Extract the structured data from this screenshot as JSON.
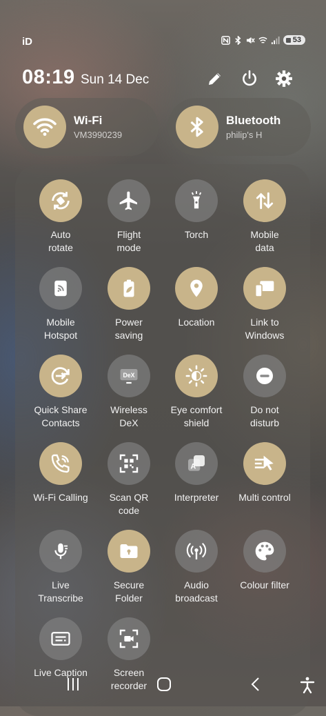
{
  "status_bar": {
    "left": "iD",
    "battery": "53"
  },
  "header": {
    "time": "08:19",
    "date": "Sun 14 Dec"
  },
  "pills": [
    {
      "title": "Wi-Fi",
      "subtitle": "VM3990239"
    },
    {
      "title": "Bluetooth",
      "subtitle": "philip's H"
    }
  ],
  "tiles": [
    {
      "label": "Auto\nrotate",
      "on": true,
      "icon": "auto-rotate-icon"
    },
    {
      "label": "Flight\nmode",
      "on": false,
      "icon": "airplane-icon"
    },
    {
      "label": "Torch",
      "on": false,
      "icon": "torch-icon"
    },
    {
      "label": "Mobile\ndata",
      "on": true,
      "icon": "mobile-data-icon"
    },
    {
      "label": "Mobile\nHotspot",
      "on": false,
      "icon": "hotspot-icon"
    },
    {
      "label": "Power\nsaving",
      "on": true,
      "icon": "battery-leaf-icon"
    },
    {
      "label": "Location",
      "on": true,
      "icon": "location-pin-icon"
    },
    {
      "label": "Link to\nWindows",
      "on": true,
      "icon": "link-windows-icon"
    },
    {
      "label": "Quick Share\nContacts",
      "on": true,
      "icon": "quick-share-icon"
    },
    {
      "label": "Wireless\nDeX",
      "on": false,
      "icon": "dex-icon"
    },
    {
      "label": "Eye comfort\nshield",
      "on": true,
      "icon": "eye-comfort-icon"
    },
    {
      "label": "Do not\ndisturb",
      "on": false,
      "icon": "do-not-disturb-icon"
    },
    {
      "label": "Wi-Fi Calling",
      "on": true,
      "icon": "wifi-calling-icon"
    },
    {
      "label": "Scan QR\ncode",
      "on": false,
      "icon": "qr-scan-icon"
    },
    {
      "label": "Interpreter",
      "on": false,
      "icon": "interpreter-icon"
    },
    {
      "label": "Multi control",
      "on": true,
      "icon": "multi-control-icon"
    },
    {
      "label": "Live\nTranscribe",
      "on": false,
      "icon": "live-transcribe-icon"
    },
    {
      "label": "Secure\nFolder",
      "on": true,
      "icon": "secure-folder-icon"
    },
    {
      "label": "Audio\nbroadcast",
      "on": false,
      "icon": "audio-broadcast-icon"
    },
    {
      "label": "Colour filter",
      "on": false,
      "icon": "colour-filter-icon"
    },
    {
      "label": "Live Caption",
      "on": false,
      "icon": "live-caption-icon"
    },
    {
      "label": "Screen\nrecorder",
      "on": false,
      "icon": "screen-recorder-icon"
    }
  ],
  "colors": {
    "active": "#c8b48a",
    "inactive": "#828282"
  }
}
